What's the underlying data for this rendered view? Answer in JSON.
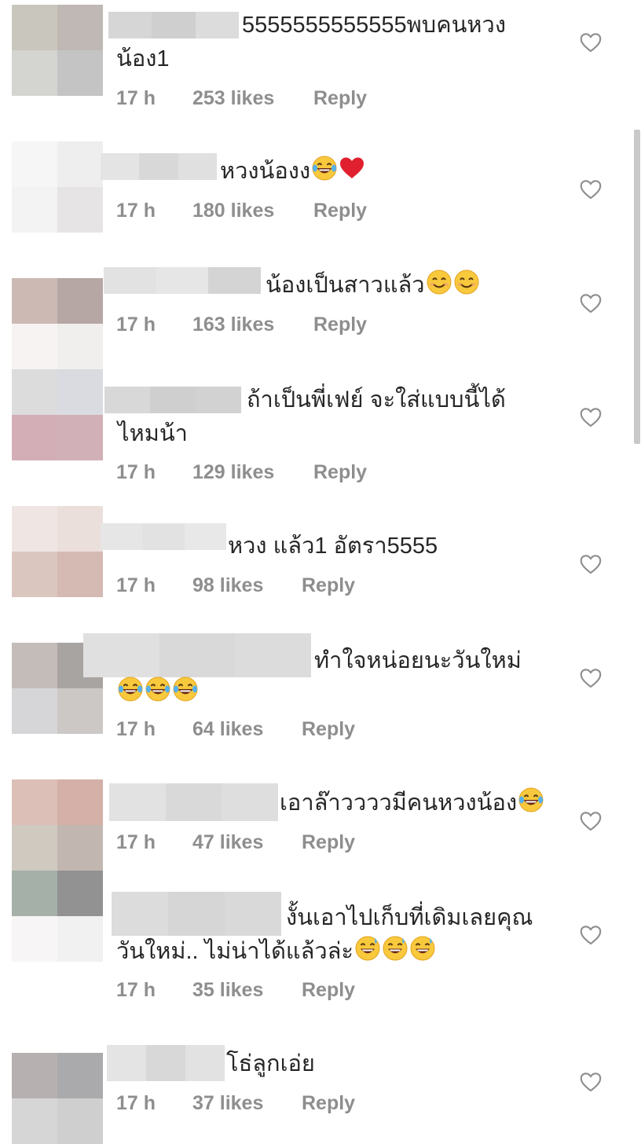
{
  "comments": [
    {
      "text_line1": "5555555555555พบคนหวง",
      "text_line2": "น้อง1",
      "emoji": [],
      "time": "17 h",
      "likes": "253 likes",
      "reply": "Reply",
      "avatar_colors": [
        "#c9c7bd",
        "#bfb8b4",
        "#d4d4d0",
        "#c4c4c4"
      ],
      "name_colors": [
        "#d6d6d6",
        "#cfcfcf",
        "#dcdcdc"
      ]
    },
    {
      "text_line1": "หวงน้องง",
      "text_line2": "",
      "emoji": [
        "laughing-tears",
        "red-heart"
      ],
      "time": "17 h",
      "likes": "180 likes",
      "reply": "Reply",
      "avatar_colors": [
        "#f6f6f6",
        "#eeeeee",
        "#f3f3f3",
        "#e6e4e4"
      ],
      "name_colors": [
        "#e4e4e4",
        "#d8d8d8",
        "#e0e0e0"
      ]
    },
    {
      "text_line1": "น้องเป็นสาวแล้ว",
      "text_line2": "",
      "emoji": [
        "smiling-face",
        "smiling-face"
      ],
      "time": "17 h",
      "likes": "163 likes",
      "reply": "Reply",
      "avatar_colors": [
        "#ccb9b4",
        "#b6a7a4",
        "#f7f3f3",
        "#f1eeee"
      ],
      "name_colors": [
        "#e2e2e2",
        "#e6e6e6",
        "#d4d4d4"
      ]
    },
    {
      "text_line1": "ถ้าเป็นพี่เฟย์ จะใส่แบบนี้ได้",
      "text_line2": "ไหมน้า",
      "emoji": [],
      "time": "17 h",
      "likes": "129 likes",
      "reply": "Reply",
      "avatar_colors": [
        "#dcdcdc",
        "#d9dbe0",
        "#d4aeb7",
        "#d2b0b8"
      ],
      "name_colors": [
        "#d8d8d8",
        "#cfcfcf",
        "#d2d2d2"
      ]
    },
    {
      "text_line1": "หวง แล้ว1 อัตรา5555",
      "text_line2": "",
      "emoji": [],
      "time": "17 h",
      "likes": "98 likes",
      "reply": "Reply",
      "avatar_colors": [
        "#efe6e4",
        "#ebdfdc",
        "#dbc6bf",
        "#d5b9b3"
      ],
      "name_colors": [
        "#e6e6e6",
        "#e2e2e2",
        "#e8e8e8"
      ]
    },
    {
      "text_line1": "ทำใจหน่อยนะวันใหม่",
      "text_line2": "",
      "emoji": [
        "laughing-tears",
        "laughing-tears",
        "laughing-tears"
      ],
      "time": "17 h",
      "likes": "64 likes",
      "reply": "Reply",
      "avatar_colors": [
        "#c4bcb8",
        "#a8a4a2",
        "#d6d6d8",
        "#ccc8c6"
      ],
      "name_colors": [
        "#e0e0e0",
        "#d9d9d9",
        "#dcdcdc"
      ]
    },
    {
      "text_line1": "เอาล๊าววววมีคนหวงน้อง",
      "text_line2": "",
      "emoji": [
        "laughing-tears"
      ],
      "time": "17 h",
      "likes": "47 likes",
      "reply": "Reply",
      "avatar_colors": [
        "#dcbfb6",
        "#d4b0a8",
        "#cfc9c0",
        "#c2b7b0"
      ],
      "name_colors": [
        "#e2e2e2",
        "#d9d9d9",
        "#dedede"
      ]
    },
    {
      "text_line1": "งั้นเอาไปเก็บที่เดิมเลยคุณ",
      "text_line2": "วันใหม่.. ไม่น่าได้แล้วล่ะ",
      "emoji": [
        "sweat-smile",
        "sweat-smile",
        "sweat-smile"
      ],
      "time": "17 h",
      "likes": "35 likes",
      "reply": "Reply",
      "avatar_colors": [
        "#a5b0a8",
        "#929292",
        "#f7f5f5",
        "#f2f1f1"
      ],
      "name_colors": [
        "#dcdcdc",
        "#d6d6d6",
        "#d9d9d9"
      ]
    },
    {
      "text_line1": "โธ่ลูกเอ่ย",
      "text_line2": "",
      "emoji": [],
      "time": "17 h",
      "likes": "37 likes",
      "reply": "Reply",
      "avatar_colors": [
        "#b6b1b0",
        "#aaaaac",
        "#d7d6d6",
        "#cfcfcf"
      ],
      "name_colors": [
        "#e4e4e4",
        "#d8d8d8",
        "#e2e2e2"
      ]
    }
  ],
  "colors": {
    "text": "#262626",
    "meta": "#8e8e8e",
    "heart_outline": "#8e8e8e"
  },
  "icons": {
    "like": "heart-outline-icon"
  }
}
